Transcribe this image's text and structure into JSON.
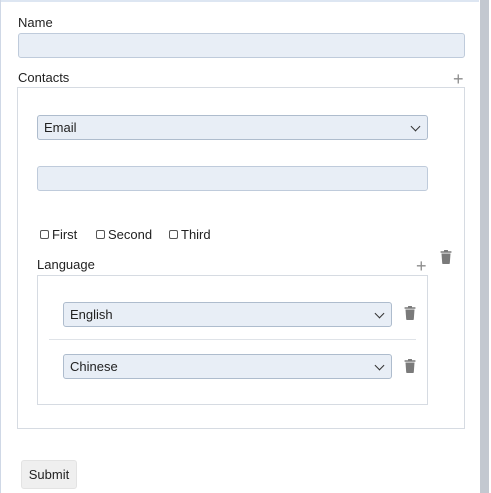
{
  "form": {
    "name_label": "Name",
    "name_value": "",
    "contacts_label": "Contacts",
    "add_icon": "plus-icon",
    "contact": {
      "type_selected": "Email",
      "type_options": [
        "Email"
      ],
      "value": "",
      "checkboxes": [
        {
          "label": "First",
          "checked": false
        },
        {
          "label": "Second",
          "checked": false
        },
        {
          "label": "Third",
          "checked": false
        }
      ],
      "language_label": "Language",
      "languages": [
        {
          "selected": "English"
        },
        {
          "selected": "Chinese"
        }
      ]
    },
    "submit_label": "Submit"
  },
  "colors": {
    "field_bg": "#e8eef6",
    "border": "#d6dbe2",
    "scrollbar": "#c3c8d0"
  }
}
